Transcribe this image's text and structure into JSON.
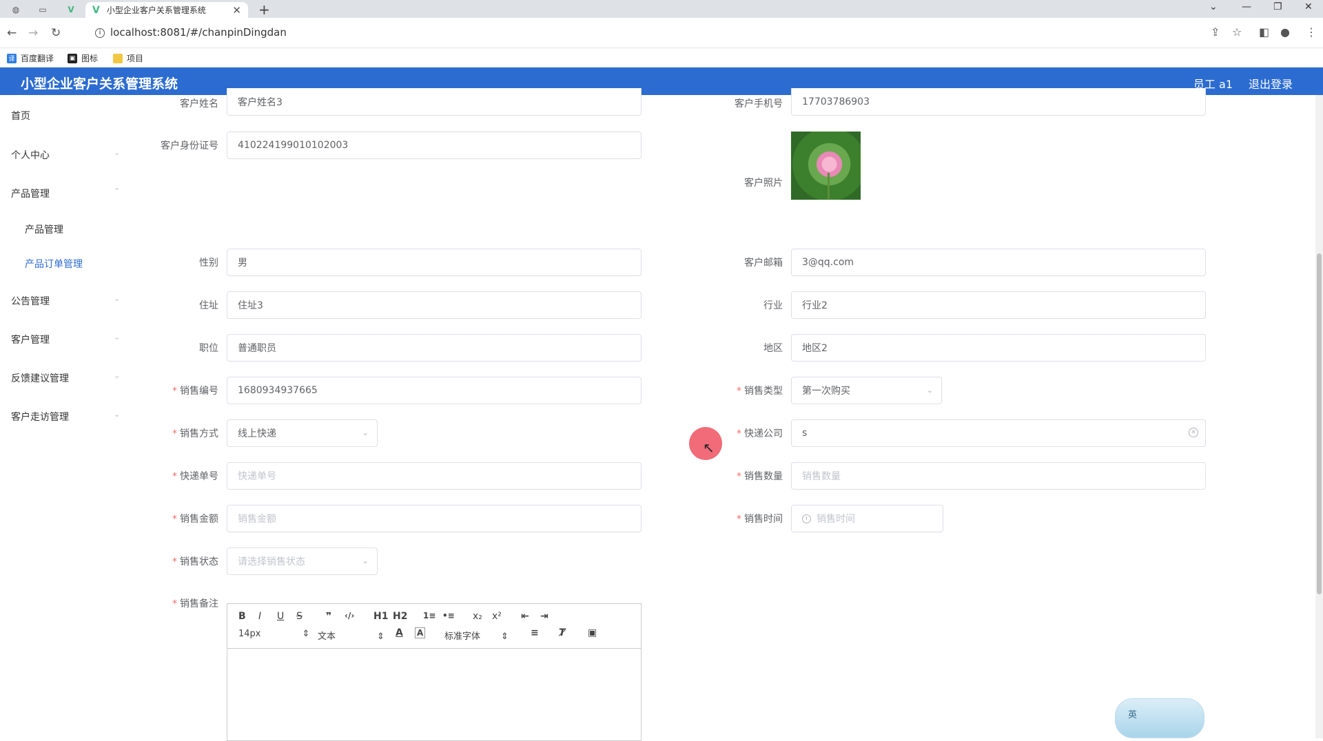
{
  "browser": {
    "tab_title": "小型企业客户关系管理系统",
    "url": "localhost:8081/#/chanpinDingdan",
    "bookmarks": [
      "百度翻译",
      "图标",
      "项目"
    ]
  },
  "header": {
    "title": "小型企业客户关系管理系统",
    "user": "员工 a1",
    "logout": "退出登录"
  },
  "sidebar": {
    "items": [
      {
        "label": "首页"
      },
      {
        "label": "个人中心"
      },
      {
        "label": "产品管理"
      },
      {
        "label": "公告管理"
      },
      {
        "label": "客户管理"
      },
      {
        "label": "反馈建议管理"
      },
      {
        "label": "客户走访管理"
      }
    ],
    "sub_items": [
      {
        "label": "产品管理"
      },
      {
        "label": "产品订单管理"
      }
    ]
  },
  "form": {
    "customer_name": {
      "label": "客户姓名",
      "value": "客户姓名3"
    },
    "customer_phone": {
      "label": "客户手机号",
      "value": "17703786903"
    },
    "customer_id": {
      "label": "客户身份证号",
      "value": "410224199010102003"
    },
    "customer_photo": {
      "label": "客户照片"
    },
    "gender": {
      "label": "性别",
      "value": "男"
    },
    "email": {
      "label": "客户邮箱",
      "value": "3@qq.com"
    },
    "address": {
      "label": "住址",
      "value": "住址3"
    },
    "industry": {
      "label": "行业",
      "value": "行业2"
    },
    "position": {
      "label": "职位",
      "value": "普通职员"
    },
    "region": {
      "label": "地区",
      "value": "地区2"
    },
    "sales_no": {
      "label": "销售编号",
      "value": "1680934937665"
    },
    "sales_type": {
      "label": "销售类型",
      "value": "第一次购买"
    },
    "sales_method": {
      "label": "销售方式",
      "value": "线上快递"
    },
    "courier": {
      "label": "快递公司",
      "value": "s"
    },
    "tracking_no": {
      "label": "快递单号",
      "placeholder": "快递单号"
    },
    "sales_qty": {
      "label": "销售数量",
      "placeholder": "销售数量"
    },
    "sales_amount": {
      "label": "销售金额",
      "placeholder": "销售金额"
    },
    "sales_time": {
      "label": "销售时间",
      "placeholder": "销售时间"
    },
    "sales_status": {
      "label": "销售状态",
      "placeholder": "请选择销售状态"
    },
    "sales_remark": {
      "label": "销售备注"
    }
  },
  "editor": {
    "font_size": "14px",
    "text_style": "文本",
    "font_family": "标准字体",
    "buttons": [
      "B",
      "I",
      "U",
      "S",
      "❞",
      "‹/›",
      "H1",
      "H2",
      "1≡",
      "•≡",
      "x₂",
      "x²",
      "⇤",
      "⇥"
    ]
  },
  "ime": {
    "label": "英"
  }
}
